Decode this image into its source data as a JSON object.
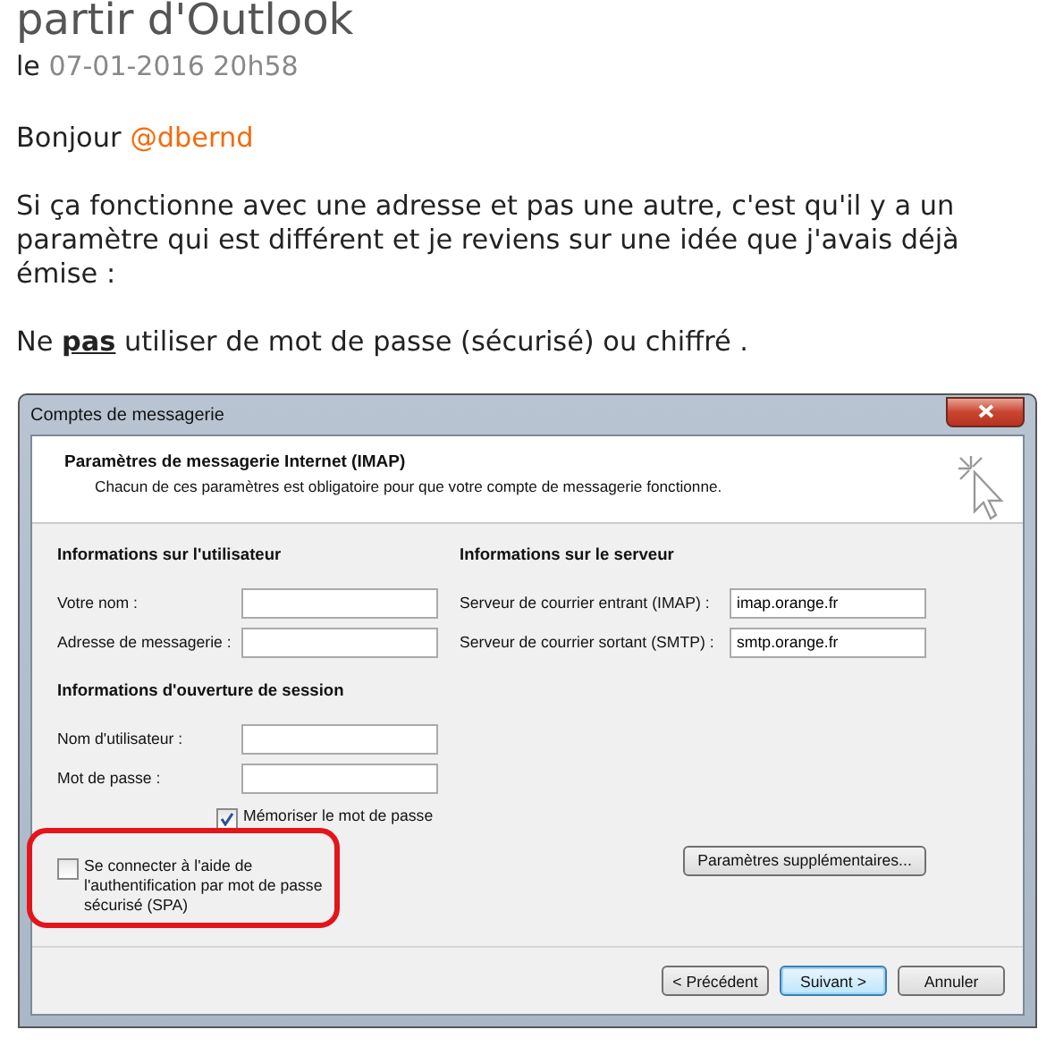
{
  "post": {
    "title": "partir d'Outlook",
    "date_prefix": "le",
    "date": "07-01-2016 20h58",
    "greeting": "Bonjour",
    "mention": "@dbernd",
    "paragraphs": [
      "Si ça fonctionne avec une adresse et pas une autre, c'est qu'il y a un paramètre qui est différent et je reviens sur une idée que j'avais déjà émise :",
      "Ne **pas** utiliser de mot de passe (sécurisé) ou chiffré ."
    ]
  },
  "dialog": {
    "title": "Comptes de messagerie",
    "header_title": "Paramètres de messagerie Internet (IMAP)",
    "header_subtitle": "Chacun de ces paramètres est obligatoire pour que votre compte de messagerie fonctionne.",
    "user_section": {
      "heading": "Informations sur l'utilisateur",
      "fields": [
        {
          "label": "Votre nom :"
        },
        {
          "label": "Adresse de messagerie :"
        }
      ]
    },
    "server_section": {
      "heading": "Informations sur le serveur",
      "fields": [
        {
          "label": "Serveur de courrier entrant (IMAP) :",
          "value": "imap.orange.fr"
        },
        {
          "label": "Serveur de courrier sortant (SMTP) :",
          "value": "smtp.orange.fr"
        }
      ]
    },
    "login_section": {
      "heading": "Informations d'ouverture de session",
      "fields": [
        {
          "label": "Nom d'utilisateur :"
        },
        {
          "label": "Mot de passe :"
        }
      ],
      "remember": {
        "label": "Mémoriser le mot de passe",
        "checked": true
      }
    },
    "spa": {
      "label": "Se connecter à l'aide de l'authentification par mot de passe sécurisé (SPA)",
      "checked": false,
      "highlighted": true
    },
    "more_button": "Paramètres supplémentaires...",
    "buttons": [
      {
        "label": "< Précédent",
        "default": false
      },
      {
        "label": "Suivant >",
        "default": true
      },
      {
        "label": "Annuler",
        "default": false
      }
    ]
  }
}
